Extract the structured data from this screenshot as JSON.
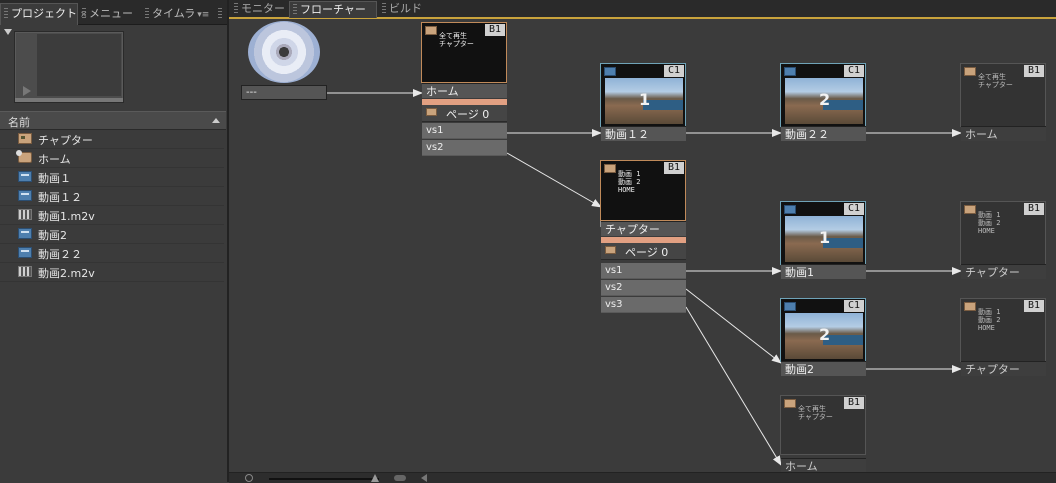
{
  "left_panel": {
    "tabs": [
      {
        "label": "プロジェクト",
        "close": "×"
      },
      {
        "label": "メニュー"
      },
      {
        "label": "タイムラ"
      }
    ],
    "column_header": "名前",
    "items": [
      {
        "label": "チャプター",
        "icon": "menu-icon"
      },
      {
        "label": "ホーム",
        "icon": "home-menu-icon"
      },
      {
        "label": "動画１",
        "icon": "timeline-icon"
      },
      {
        "label": "動画１２",
        "icon": "timeline-icon"
      },
      {
        "label": "動画1.m2v",
        "icon": "video-file-icon"
      },
      {
        "label": "動画2",
        "icon": "timeline-icon"
      },
      {
        "label": "動画２２",
        "icon": "timeline-icon"
      },
      {
        "label": "動画2.m2v",
        "icon": "video-file-icon"
      }
    ]
  },
  "right_panel": {
    "tabs": [
      {
        "label": "モニター"
      },
      {
        "label": "フローチャート",
        "close": "×"
      },
      {
        "label": "ビルド"
      }
    ]
  },
  "flowchart": {
    "disc_label": "---",
    "menu_home": {
      "badge": "B1",
      "text": "全て再生\nチャプター",
      "label": "ホーム",
      "page": "ページ 0",
      "buttons": [
        "vs1",
        "vs2"
      ]
    },
    "menu_chapter": {
      "badge": "B1",
      "text": "動画 1\n動画 2\nHOME",
      "label": "チャプター",
      "page": "ページ 0",
      "buttons": [
        "vs1",
        "vs2",
        "vs3"
      ]
    },
    "timelines": [
      {
        "label": "動画１２",
        "badge": "C1",
        "frame_number": "1"
      },
      {
        "label": "動画２２",
        "badge": "C1",
        "frame_number": "2"
      },
      {
        "label": "動画1",
        "badge": "C1",
        "frame_number": "1"
      },
      {
        "label": "動画2",
        "badge": "C1",
        "frame_number": "2"
      }
    ],
    "end_actions": [
      {
        "label": "ホーム",
        "badge": "B1",
        "text": "全て再生\nチャプター"
      },
      {
        "label": "チャプター",
        "badge": "B1",
        "text": "動画 1\n動画 2\nHOME"
      },
      {
        "label": "チャプター",
        "badge": "B1",
        "text": "動画 1\n動画 2\nHOME"
      },
      {
        "label": "ホーム",
        "badge": "B1",
        "text": "全て再生\nチャプター"
      }
    ]
  },
  "colors": {
    "accent_tab_line": "#c9a33c",
    "menu_highlight": "#e2a082",
    "link_line": "#e8e8e8"
  }
}
